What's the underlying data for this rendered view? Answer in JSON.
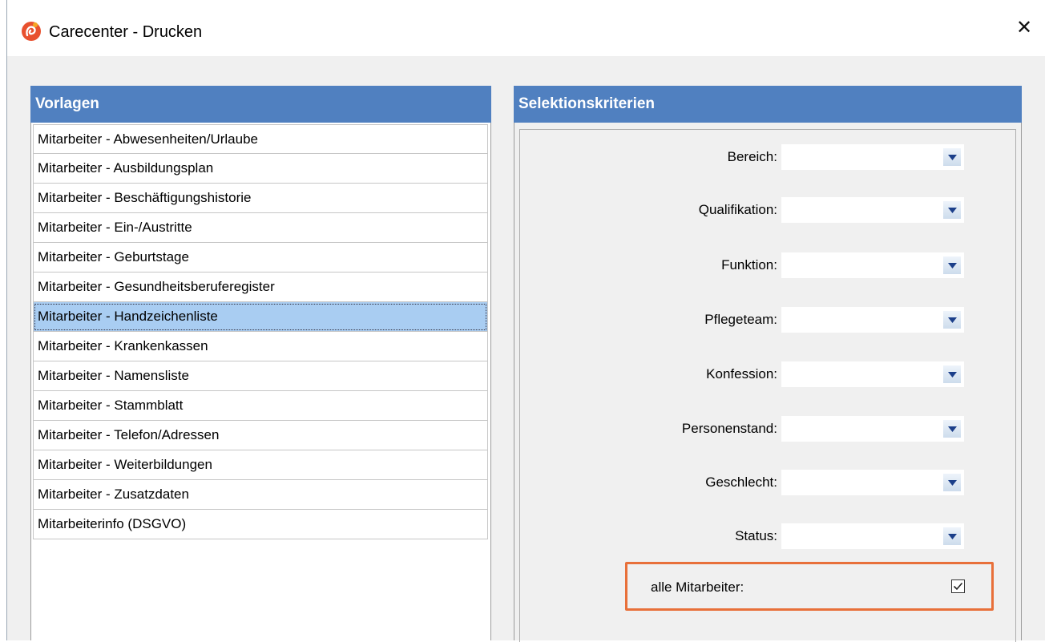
{
  "window": {
    "title": "Carecenter - Drucken",
    "close_glyph": "✕"
  },
  "templates": {
    "header": "Vorlagen",
    "items": [
      "Mitarbeiter - Abwesenheiten/Urlaube",
      "Mitarbeiter - Ausbildungsplan",
      "Mitarbeiter - Beschäftigungshistorie",
      "Mitarbeiter - Ein-/Austritte",
      "Mitarbeiter - Geburtstage",
      "Mitarbeiter - Gesundheitsberuferegister",
      "Mitarbeiter - Handzeichenliste",
      "Mitarbeiter - Krankenkassen",
      "Mitarbeiter - Namensliste",
      "Mitarbeiter - Stammblatt",
      "Mitarbeiter - Telefon/Adressen",
      "Mitarbeiter - Weiterbildungen",
      "Mitarbeiter - Zusatzdaten",
      "Mitarbeiterinfo (DSGVO)"
    ],
    "selected_index": 6
  },
  "criteria": {
    "header": "Selektionskriterien",
    "fields": [
      {
        "label": "Bereich:",
        "value": ""
      },
      {
        "label": "Qualifikation:",
        "value": ""
      },
      {
        "label": "Funktion:",
        "value": ""
      },
      {
        "label": "Pflegeteam:",
        "value": ""
      },
      {
        "label": "Konfession:",
        "value": ""
      },
      {
        "label": "Personenstand:",
        "value": ""
      },
      {
        "label": "Geschlecht:",
        "value": ""
      },
      {
        "label": "Status:",
        "value": ""
      }
    ],
    "all_employees": {
      "label": "alle Mitarbeiter:",
      "checked": true
    }
  },
  "colors": {
    "header_bg": "#5080c0",
    "selected_bg": "#a9cdf2",
    "highlight_border": "#e8703a"
  }
}
